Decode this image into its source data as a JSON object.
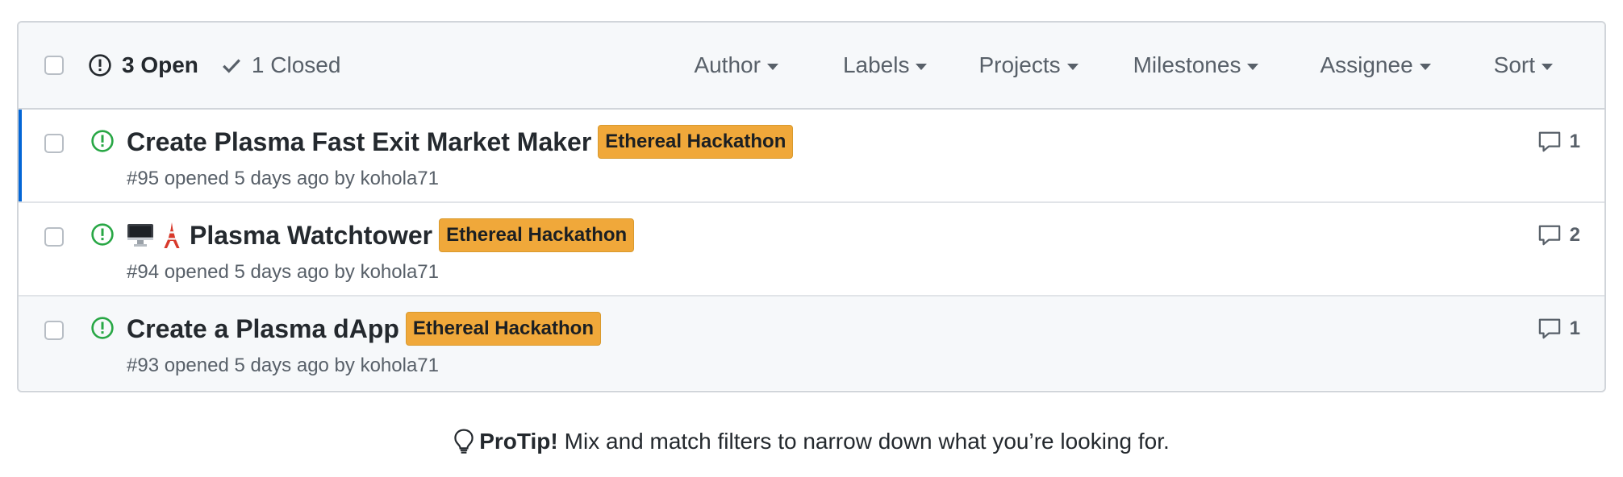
{
  "header": {
    "open_label": "3 Open",
    "closed_label": "1 Closed",
    "filters": [
      "Author",
      "Labels",
      "Projects",
      "Milestones",
      "Assignee",
      "Sort"
    ]
  },
  "issues": [
    {
      "title": "Create Plasma Fast Exit Market Maker",
      "label": "Ethereal Hackathon",
      "meta": "#95 opened 5 days ago by kohola71",
      "comments": "1",
      "emoji": []
    },
    {
      "title": "Plasma Watchtower",
      "label": "Ethereal Hackathon",
      "meta": "#94 opened 5 days ago by kohola71",
      "comments": "2",
      "emoji": [
        "desktop-computer-icon",
        "tokyo-tower-icon"
      ]
    },
    {
      "title": "Create a Plasma dApp",
      "label": "Ethereal Hackathon",
      "meta": "#93 opened 5 days ago by kohola71",
      "comments": "1",
      "emoji": []
    }
  ],
  "protip": {
    "bold": "ProTip!",
    "text": "Mix and match filters to narrow down what you’re looking for."
  },
  "colors": {
    "open_green": "#28a745",
    "label_bg": "#f0a83a",
    "selected_bar": "#0366d6"
  }
}
